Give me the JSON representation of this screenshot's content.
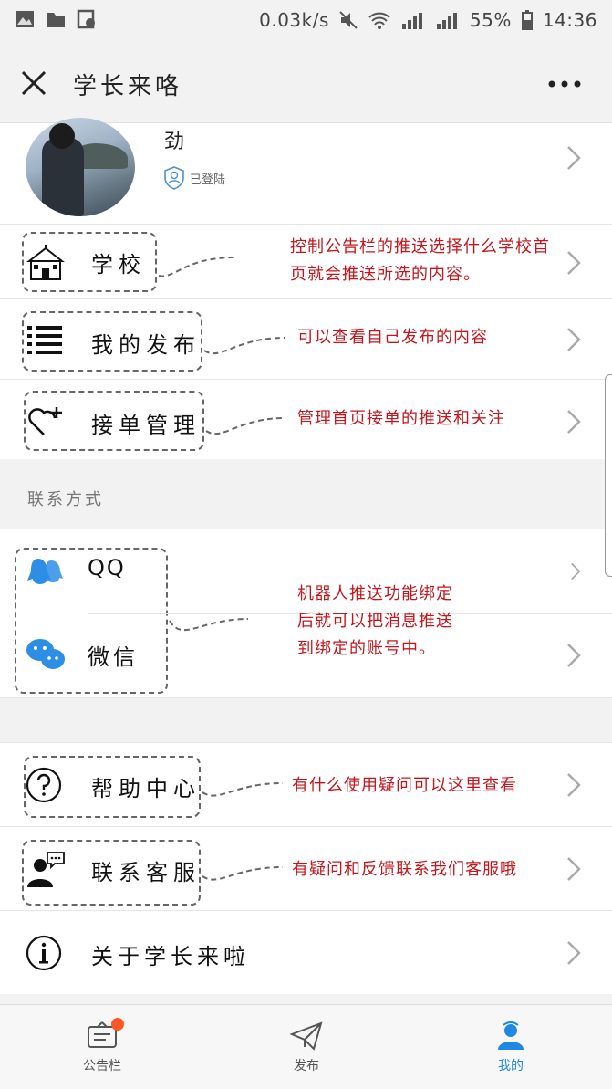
{
  "status": {
    "speed": "0.03k/s",
    "battery": "55%",
    "time": "14:36"
  },
  "header": {
    "title": "学长来咯"
  },
  "profile": {
    "username": "劲",
    "login_status": "已登陆"
  },
  "rows": {
    "school": {
      "label": "学校",
      "note": "控制公告栏的推送选择什么学校首页就会推送所选的内容。"
    },
    "my_posts": {
      "label": "我的发布",
      "note": "可以查看自己发布的内容"
    },
    "orders": {
      "label": "接单管理",
      "note": "管理首页接单的推送和关注"
    }
  },
  "contact_section": {
    "title": "联系方式",
    "qq": "QQ",
    "wechat": "微信",
    "note_line1": "机器人推送功能绑定",
    "note_line2": "后就可以把消息推送",
    "note_line3": "到绑定的账号中。"
  },
  "help": {
    "help_center": {
      "label": "帮助中心",
      "note": "有什么使用疑问可以这里查看"
    },
    "customer_service": {
      "label": "联系客服",
      "note": "有疑问和反馈联系我们客服哦"
    },
    "about": {
      "label": "关于学长来啦"
    }
  },
  "tabs": {
    "notice": "公告栏",
    "publish": "发布",
    "mine": "我的"
  },
  "colors": {
    "accent": "#1e88e5",
    "annotation": "#c4161c",
    "badge": "#ff5722"
  }
}
